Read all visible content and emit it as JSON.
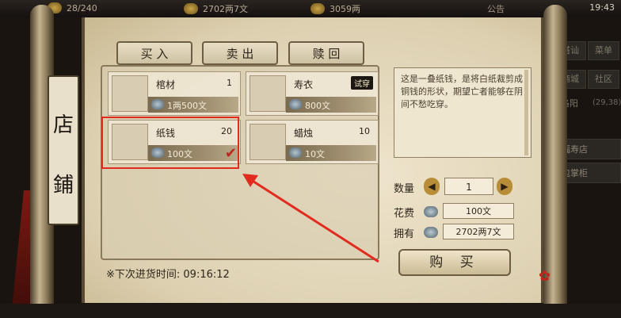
{
  "topbar": {
    "currency1": "28/240",
    "currency2": "2702两7文",
    "currency3": "3059两",
    "notice": "公告",
    "time": "19:43"
  },
  "sidemenu": {
    "btn1": "搭讪",
    "btn2": "菜单",
    "btn3": "商城",
    "btn4": "社区",
    "location": "洛阳",
    "coords": "(29,38)",
    "shop1": "福寿店",
    "shop2": "包掌柜"
  },
  "title": {
    "char1": "店",
    "char2": "鋪"
  },
  "tabs": {
    "buy": "买 入",
    "sell": "卖 出",
    "redeem": "赎 回"
  },
  "items": [
    {
      "name": "棺材",
      "qty": "1",
      "price": "1两500文",
      "icon": "coffin-icon"
    },
    {
      "name": "寿衣",
      "qty": "",
      "price": "800文",
      "badge": "试穿",
      "icon": "burial-clothes-icon"
    },
    {
      "name": "纸钱",
      "qty": "20",
      "price": "100文",
      "icon": "paper-money-icon",
      "selected": true
    },
    {
      "name": "蜡烛",
      "qty": "10",
      "price": "10文",
      "icon": "candle-icon"
    }
  ],
  "restock": "※下次进货时间: 09:16:12",
  "detail": {
    "description": "这是一叠纸钱，是将白纸裁剪成铜钱的形状，期望亡者能够在阴间不愁吃穿。",
    "quantity_label": "数量",
    "quantity_value": "1",
    "cost_label": "花费",
    "cost_value": "100文",
    "owned_label": "拥有",
    "owned_value": "2702两7文",
    "buy_label": "购 买"
  },
  "colors": {
    "highlight": "#e12b1f",
    "accent": "#b88d38"
  }
}
